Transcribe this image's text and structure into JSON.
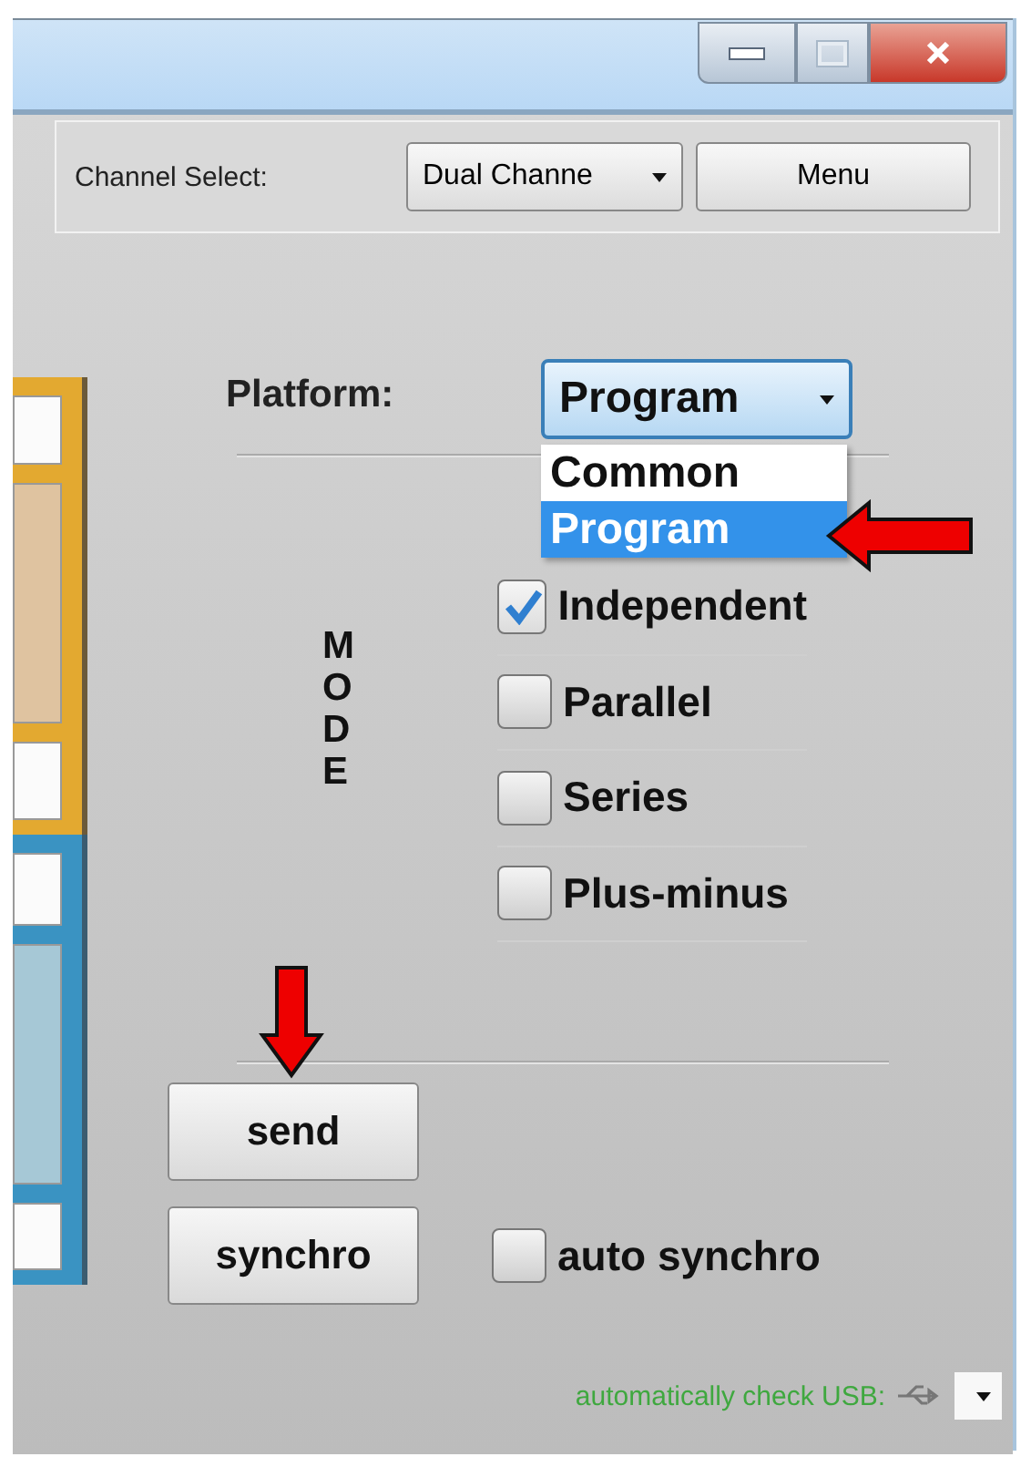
{
  "toolbar": {
    "channel_label": "Channel Select:",
    "channel_value": "Dual Channe",
    "menu_button": "Menu"
  },
  "platform": {
    "label": "Platform:",
    "value": "Program",
    "options": [
      {
        "label": "Common",
        "selected": false
      },
      {
        "label": "Program",
        "selected": true
      }
    ]
  },
  "mode": {
    "label": "MODE",
    "options": [
      {
        "label": "Independent",
        "checked": true
      },
      {
        "label": "Parallel",
        "checked": false
      },
      {
        "label": "Series",
        "checked": false
      },
      {
        "label": "Plus-minus",
        "checked": false
      }
    ]
  },
  "send_button": "send",
  "synchro_button": "synchro",
  "auto_synchro": {
    "label": "auto synchro",
    "checked": false
  },
  "status_bar": {
    "text": "automatically check USB:"
  }
}
